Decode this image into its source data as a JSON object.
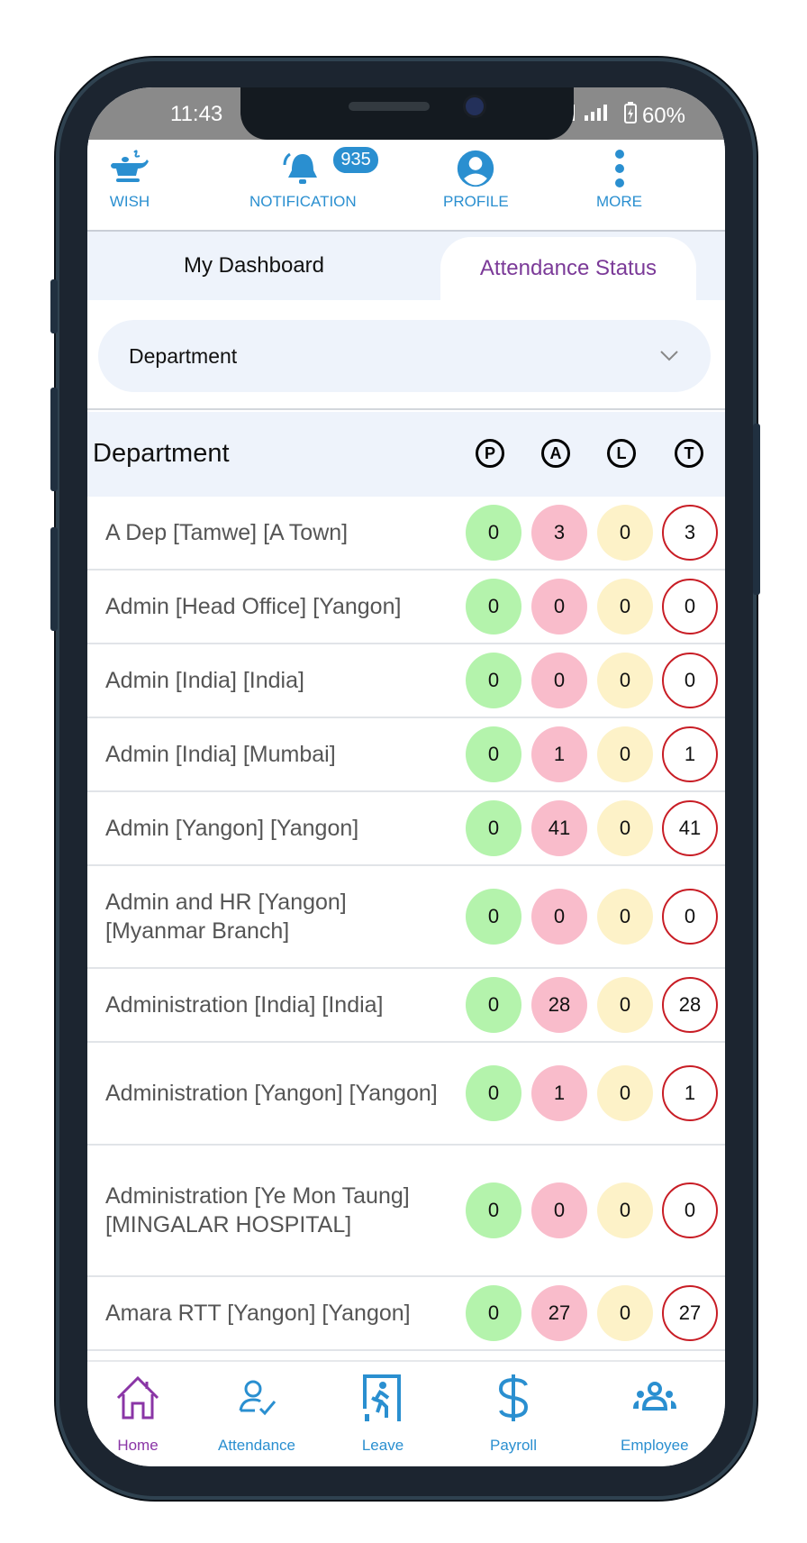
{
  "status_bar": {
    "time": "11:43",
    "battery": "60%"
  },
  "top_nav": {
    "items": [
      {
        "label": "WISH",
        "icon": "teapot-icon"
      },
      {
        "label": "NOTIFICATION",
        "icon": "bell-icon",
        "badge": "935"
      },
      {
        "label": "PROFILE",
        "icon": "user-circle-icon"
      },
      {
        "label": "MORE",
        "icon": "more-vertical-icon"
      }
    ]
  },
  "tabs": [
    {
      "label": "My Dashboard",
      "active": false
    },
    {
      "label": "Attendance Status",
      "active": true
    }
  ],
  "filter": {
    "selected": "Department",
    "icon": "chevron-down-icon"
  },
  "table": {
    "header": {
      "title": "Department",
      "columns": [
        "P",
        "A",
        "L",
        "T"
      ]
    },
    "rows": [
      {
        "name": "A Dep [Tamwe] [A Town]",
        "p": "0",
        "a": "3",
        "l": "0",
        "t": "3"
      },
      {
        "name": "Admin [Head Office] [Yangon]",
        "p": "0",
        "a": "0",
        "l": "0",
        "t": "0"
      },
      {
        "name": "Admin [India] [India]",
        "p": "0",
        "a": "0",
        "l": "0",
        "t": "0"
      },
      {
        "name": "Admin [India] [Mumbai]",
        "p": "0",
        "a": "1",
        "l": "0",
        "t": "1"
      },
      {
        "name": "Admin [Yangon] [Yangon]",
        "p": "0",
        "a": "41",
        "l": "0",
        "t": "41"
      },
      {
        "name": "Admin and HR [Yangon] [Myanmar Branch]",
        "p": "0",
        "a": "0",
        "l": "0",
        "t": "0"
      },
      {
        "name": "Administration [India] [India]",
        "p": "0",
        "a": "28",
        "l": "0",
        "t": "28"
      },
      {
        "name": "Administration [Yangon] [Yangon]",
        "p": "0",
        "a": "1",
        "l": "0",
        "t": "1"
      },
      {
        "name": "Administration [Ye Mon Taung] [MINGALAR HOSPITAL]",
        "p": "0",
        "a": "0",
        "l": "0",
        "t": "0"
      },
      {
        "name": "Amara RTT [Yangon] [Yangon]",
        "p": "0",
        "a": "27",
        "l": "0",
        "t": "27"
      }
    ]
  },
  "bottom_nav": {
    "items": [
      {
        "label": "Home",
        "icon": "home-icon",
        "active": true
      },
      {
        "label": "Attendance",
        "icon": "attendance-check-icon",
        "active": false
      },
      {
        "label": "Leave",
        "icon": "exit-door-icon",
        "active": false
      },
      {
        "label": "Payroll",
        "icon": "dollar-icon",
        "active": false
      },
      {
        "label": "Employee",
        "icon": "group-icon",
        "active": false
      }
    ]
  },
  "colors": {
    "accent_blue": "#2a8fd0",
    "accent_purple": "#7b3a98",
    "present": "#b4f3ac",
    "absent": "#f9bccb",
    "leave": "#fdf2c8",
    "total_border": "#c81d25"
  }
}
